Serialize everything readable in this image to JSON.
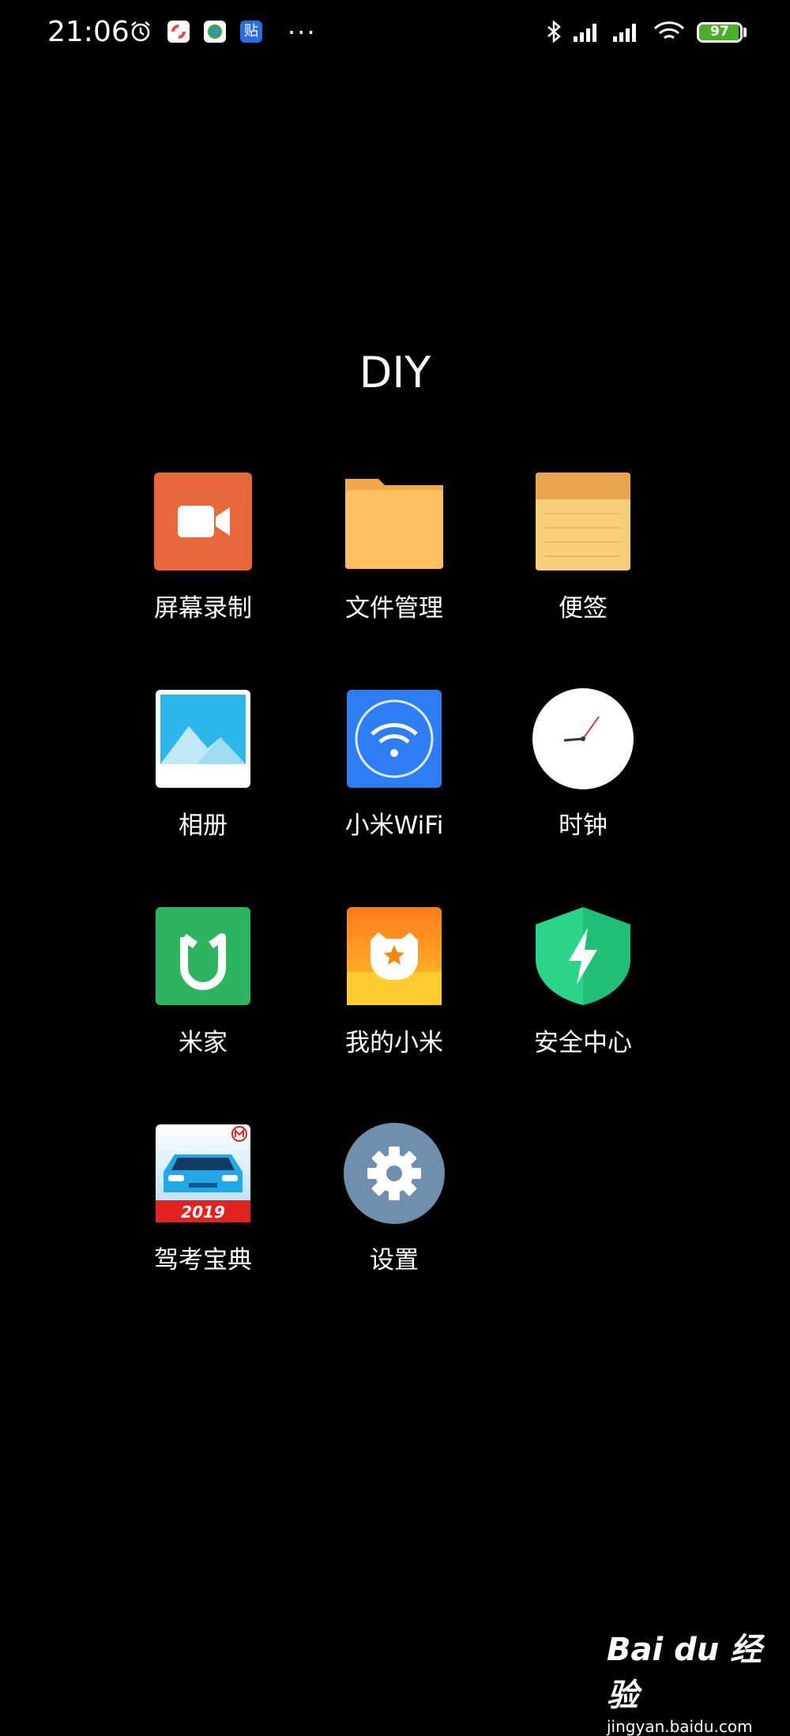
{
  "status_bar": {
    "time": "21:06",
    "notification_badge": "贴",
    "overflow": "···",
    "battery_level": 97,
    "battery_text": "97"
  },
  "folder": {
    "title": "DIY",
    "apps": [
      {
        "label": "屏幕录制",
        "icon": "screen-recorder-icon"
      },
      {
        "label": "文件管理",
        "icon": "folder-icon"
      },
      {
        "label": "便签",
        "icon": "notes-icon"
      },
      {
        "label": "相册",
        "icon": "gallery-icon"
      },
      {
        "label": "小米WiFi",
        "icon": "wifi-icon"
      },
      {
        "label": "时钟",
        "icon": "clock-icon"
      },
      {
        "label": "米家",
        "icon": "mijia-icon"
      },
      {
        "label": "我的小米",
        "icon": "mi-bunny-icon"
      },
      {
        "label": "安全中心",
        "icon": "shield-bolt-icon"
      },
      {
        "label": "驾考宝典",
        "icon": "car-icon",
        "badge_text": "2019"
      },
      {
        "label": "设置",
        "icon": "gear-icon"
      }
    ]
  },
  "watermark": {
    "logo_text": "Bai du 经验",
    "url": "jingyan.baidu.com"
  },
  "colors": {
    "background": "#000000",
    "battery": "#4caf2a",
    "recorder": "#e8673a",
    "folder": "#fec05e",
    "notes": "#f7cf7a",
    "wifi": "#2f7df5",
    "mijia": "#2eb360",
    "security": "#2bd488",
    "settings": "#6f8fad"
  }
}
